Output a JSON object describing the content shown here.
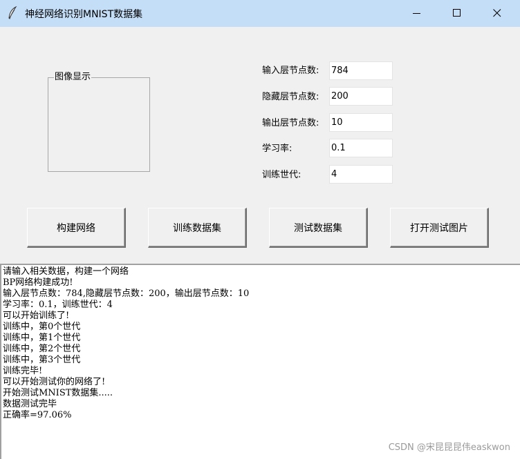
{
  "window": {
    "title": "神经网络识别MNIST数据集",
    "icon": "feather-icon",
    "controls": [
      "minimize-icon",
      "maximize-icon",
      "close-icon"
    ]
  },
  "image_panel": {
    "label": "图像显示"
  },
  "form": {
    "input_nodes_label": "输入层节点数:",
    "input_nodes_value": "784",
    "hidden_nodes_label": "隐藏层节点数:",
    "hidden_nodes_value": "200",
    "output_nodes_label": "输出层节点数:",
    "output_nodes_value": "10",
    "learning_rate_label": "学习率:",
    "learning_rate_value": "0.1",
    "epochs_label": "训练世代:",
    "epochs_value": "4"
  },
  "buttons": {
    "build": "构建网络",
    "train": "训练数据集",
    "test": "测试数据集",
    "open": "打开测试图片"
  },
  "log": [
    "请输入相关数据，构建一个网络",
    "BP网络构建成功!",
    "输入层节点数：784,隐藏层节点数：200，输出层节点数：10",
    "学习率：0.1，训练世代：4",
    "可以开始训练了!",
    "训练中，第0个世代",
    "训练中，第1个世代",
    "训练中，第2个世代",
    "训练中，第3个世代",
    "训练完毕!",
    "可以开始测试你的网络了!",
    "开始测试MNIST数据集.....",
    "数据测试完毕",
    "正确率=97.06%"
  ],
  "watermark": "CSDN @宋昆昆昆伟easkwon"
}
